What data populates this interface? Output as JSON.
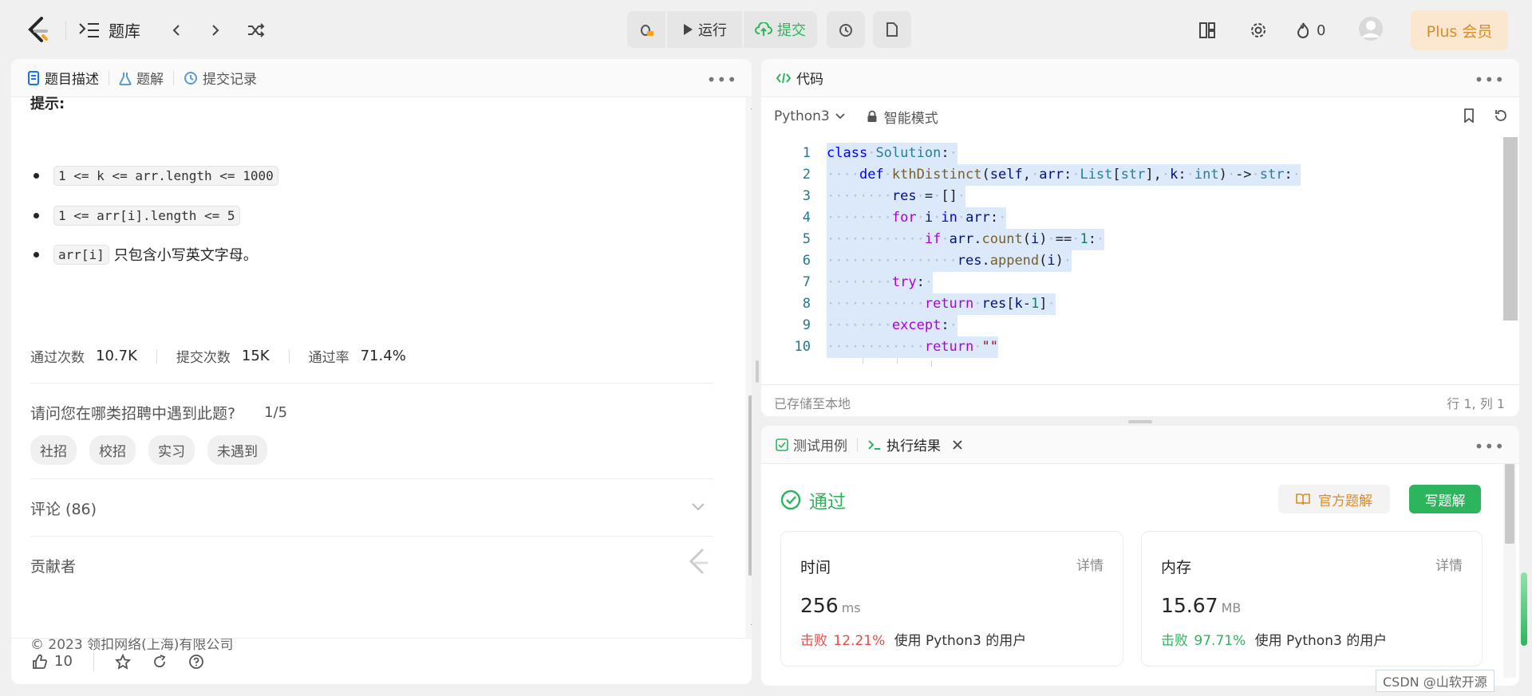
{
  "topbar": {
    "library_label": "题库",
    "run_label": "运行",
    "submit_label": "提交",
    "streak_count": "0",
    "plus_label": "Plus 会员"
  },
  "left_panel": {
    "tabs": [
      {
        "label": "题目描述",
        "icon": "description-icon"
      },
      {
        "label": "题解",
        "icon": "flask-icon"
      },
      {
        "label": "提交记录",
        "icon": "history-icon"
      }
    ],
    "hint_title": "提示:",
    "constraints": [
      {
        "code": "1 <= k <= arr.length <= 1000",
        "text": ""
      },
      {
        "code": "1 <= arr[i].length <= 5",
        "text": ""
      },
      {
        "code": "arr[i]",
        "text": "只包含小写英文字母。"
      }
    ],
    "stats": [
      {
        "label": "通过次数",
        "value": "10.7K"
      },
      {
        "label": "提交次数",
        "value": "15K"
      },
      {
        "label": "通过率",
        "value": "71.4%"
      }
    ],
    "survey_question": "请问您在哪类招聘中遇到此题?",
    "survey_progress": "1/5",
    "survey_options": [
      "社招",
      "校招",
      "实习",
      "未遇到"
    ],
    "comments_label": "评论 (86)",
    "contributors_label": "贡献者",
    "copyright": "© 2023 领扣网络(上海)有限公司",
    "like_count": "10"
  },
  "code_panel": {
    "title": "代码",
    "language": "Python3",
    "mode": "智能模式",
    "status_saved": "已存储至本地",
    "cursor_pos": "行 1, 列 1",
    "line_numbers": [
      "1",
      "2",
      "3",
      "4",
      "5",
      "6",
      "7",
      "8",
      "9",
      "10"
    ]
  },
  "result_panel": {
    "tabs": [
      {
        "label": "测试用例",
        "icon": "checkbox-icon"
      },
      {
        "label": "执行结果",
        "icon": "terminal-icon"
      }
    ],
    "status": "通过",
    "official_solution_label": "官方题解",
    "write_solution_label": "写题解",
    "time": {
      "title": "时间",
      "detail": "详情",
      "value": "256",
      "unit": "ms",
      "beat_label": "击败",
      "beat_pct": "12.21%",
      "beat_desc": "使用 Python3 的用户",
      "beat_color": "#ef4743"
    },
    "memory": {
      "title": "内存",
      "detail": "详情",
      "value": "15.67",
      "unit": "MB",
      "beat_label": "击败",
      "beat_pct": "97.71%",
      "beat_desc": "使用 Python3 的用户",
      "beat_color": "#2db55d"
    }
  },
  "watermark": "CSDN @山软开源",
  "colors": {
    "accent_green": "#2db55d",
    "plus_bg": "#fbe6cf",
    "plus_text": "#d98c2a"
  }
}
